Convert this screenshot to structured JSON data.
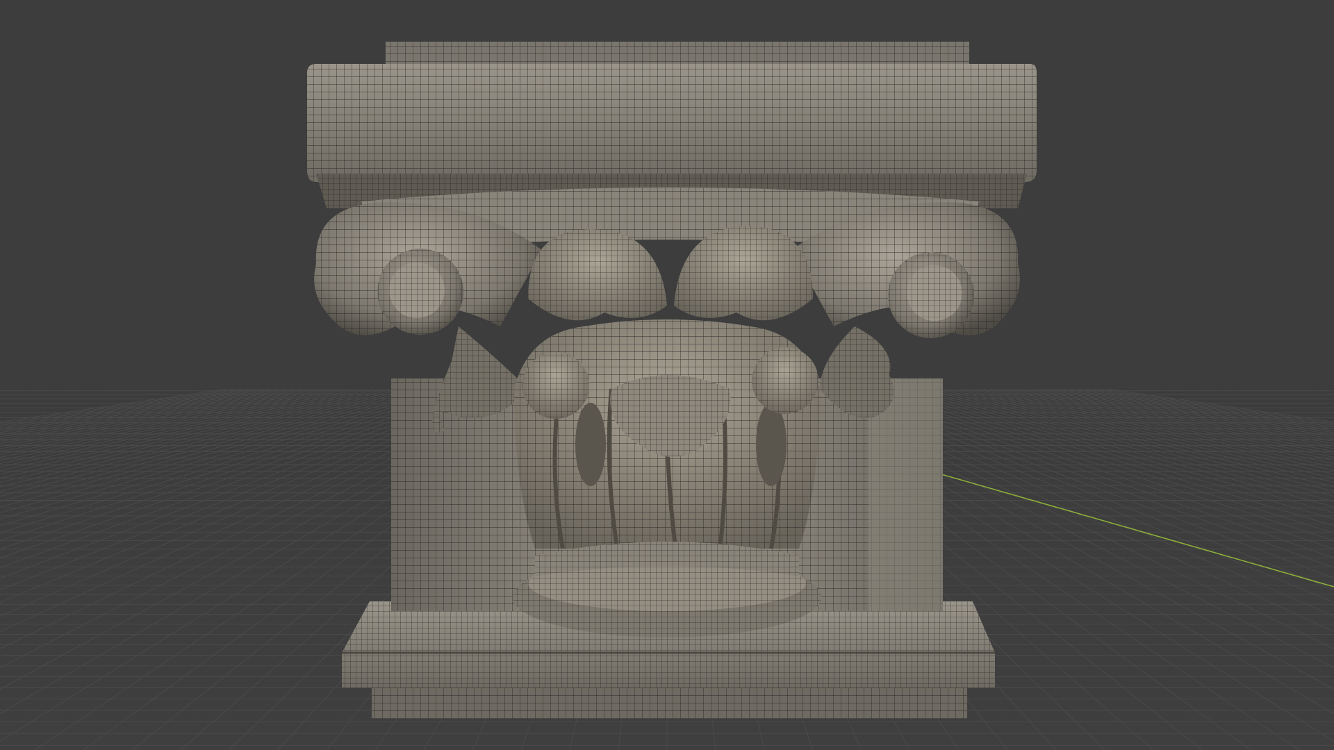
{
  "viewport": {
    "background_color": "#3d3d3d",
    "grid_color": "#4a4a4a",
    "x_axis_color": "#8cae3a"
  },
  "model": {
    "mesh_shading": "wireframe-overlay",
    "wire_color": "#1e1e1e",
    "surface_color": "#858075",
    "highlight_color": "#a8a296",
    "shadow_color": "#4a4740",
    "icon": "ionic-capital-mesh"
  }
}
